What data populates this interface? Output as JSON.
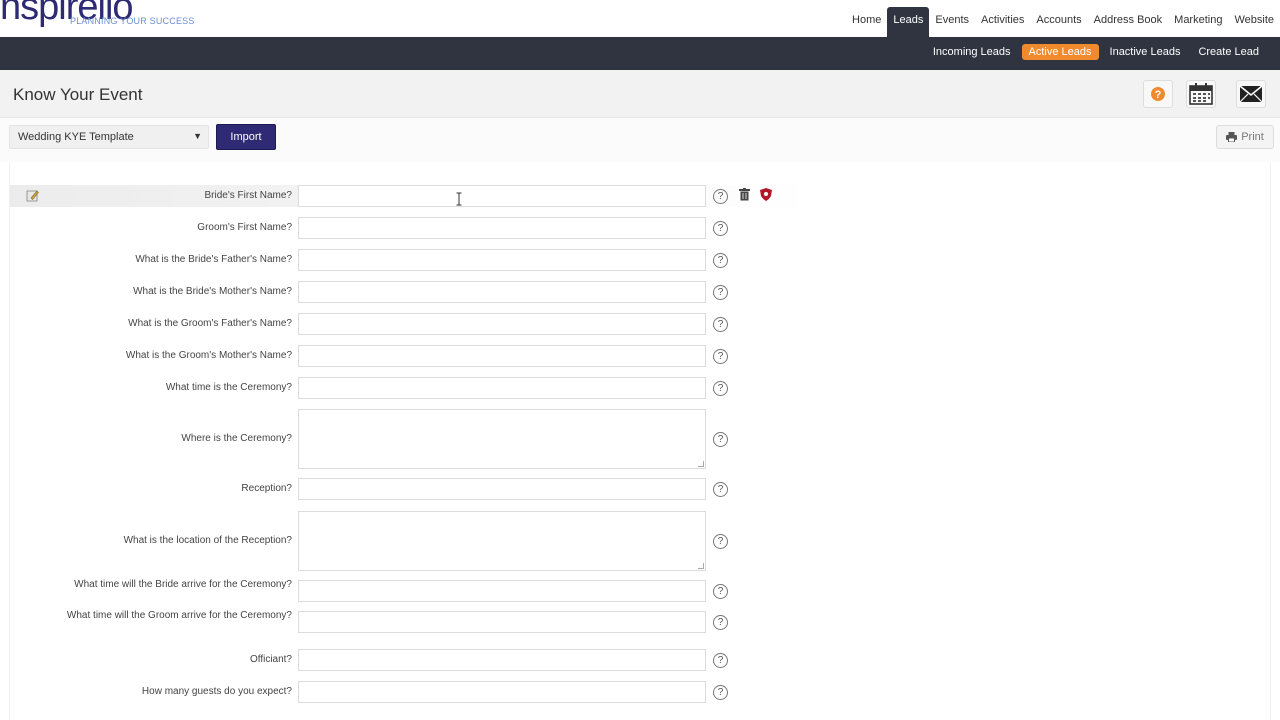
{
  "brand": {
    "logo_text": "nspirelio",
    "tagline": "PLANNING YOUR SUCCESS"
  },
  "main_nav": [
    {
      "label": "Home",
      "active": false
    },
    {
      "label": "Leads",
      "active": true
    },
    {
      "label": "Events",
      "active": false
    },
    {
      "label": "Activities",
      "active": false
    },
    {
      "label": "Accounts",
      "active": false
    },
    {
      "label": "Address Book",
      "active": false
    },
    {
      "label": "Marketing",
      "active": false
    },
    {
      "label": "Website",
      "active": false
    }
  ],
  "sub_nav": [
    {
      "label": "Incoming Leads",
      "active": false
    },
    {
      "label": "Active Leads",
      "active": true
    },
    {
      "label": "Inactive Leads",
      "active": false
    },
    {
      "label": "Create Lead",
      "active": false
    }
  ],
  "page": {
    "title": "Know Your Event"
  },
  "header_icons": {
    "help": "question-icon",
    "calendar": "calendar-icon",
    "mail": "envelope-icon"
  },
  "toolbar": {
    "template_value": "Wedding KYE Template",
    "import_label": "Import",
    "print_label": "Print"
  },
  "form": {
    "help_glyph": "?",
    "questions": [
      {
        "label": "Bride's First Name?",
        "value": ""
      },
      {
        "label": "Groom's First Name?",
        "value": ""
      },
      {
        "label": "What is the Bride's Father's Name?",
        "value": ""
      },
      {
        "label": "What is the Bride's Mother's Name?",
        "value": ""
      },
      {
        "label": "What is the Groom's Father's Name?",
        "value": ""
      },
      {
        "label": "What is the Groom's Mother's Name?",
        "value": ""
      },
      {
        "label": "What time is the Ceremony?",
        "value": ""
      },
      {
        "label": "Where is the Ceremony?",
        "value": ""
      },
      {
        "label": "Reception?",
        "value": ""
      },
      {
        "label": "What is the location of the Reception?",
        "value": ""
      },
      {
        "label": "What time will the Bride arrive for the Ceremony?",
        "value": ""
      },
      {
        "label": "What time will the Groom arrive for the Ceremony?",
        "value": ""
      },
      {
        "label": "Officiant?",
        "value": ""
      },
      {
        "label": "How many guests do you expect?",
        "value": ""
      }
    ]
  },
  "colors": {
    "brand_navy": "#2e2a73",
    "dark_bar": "#2f3440",
    "accent_orange": "#f08a2c",
    "shield_red": "#b5172a"
  }
}
